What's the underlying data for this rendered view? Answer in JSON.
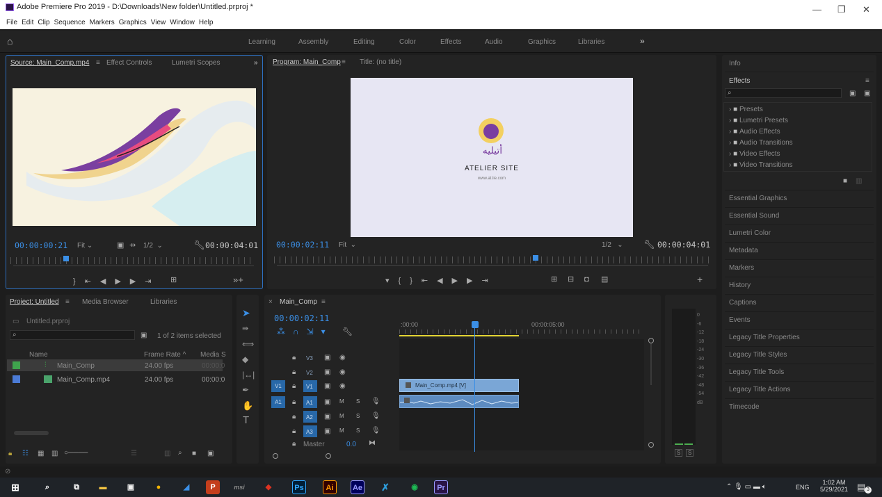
{
  "window": {
    "title": "Adobe Premiere Pro 2019 - D:\\Downloads\\New folder\\Untitled.prproj *",
    "min_icon": "—",
    "restore_icon": "❐",
    "close_icon": "✕"
  },
  "menu": [
    "File",
    "Edit",
    "Clip",
    "Sequence",
    "Markers",
    "Graphics",
    "View",
    "Window",
    "Help"
  ],
  "workspaces": [
    "Learning",
    "Assembly",
    "Editing",
    "Color",
    "Effects",
    "Audio",
    "Graphics",
    "Libraries"
  ],
  "workspace_more": "»",
  "source_panel": {
    "tabs": [
      "Source: Main_Comp.mp4",
      "Effect Controls",
      "Lumetri Scopes"
    ],
    "menu_icon": "≡",
    "more": "»",
    "timecode": "00:00:00:21",
    "fit": "Fit",
    "resolution": "1/2",
    "duration": "00:00:04:01"
  },
  "program_panel": {
    "tabs": [
      "Program: Main_Comp",
      "Title: (no title)"
    ],
    "menu_icon": "≡",
    "timecode": "00:00:02:11",
    "fit": "Fit",
    "resolution": "1/2",
    "duration": "00:00:04:01",
    "logo_arabic": "أتيليه",
    "logo_title": "ATELIER SITE",
    "logo_url": "www.at.lie.com"
  },
  "right_panel": {
    "info": "Info",
    "effects": "Effects",
    "effects_tree": [
      "Presets",
      "Lumetri Presets",
      "Audio Effects",
      "Audio Transitions",
      "Video Effects",
      "Video Transitions"
    ],
    "sections": [
      "Essential Graphics",
      "Essential Sound",
      "Lumetri Color",
      "Metadata",
      "Markers",
      "History",
      "Captions",
      "Events",
      "Legacy Title Properties",
      "Legacy Title Styles",
      "Legacy Title Tools",
      "Legacy Title Actions",
      "Timecode"
    ]
  },
  "project_panel": {
    "tabs": [
      "Project: Untitled",
      "Media Browser",
      "Libraries"
    ],
    "file": "Untitled.prproj",
    "items_selected": "1 of 2 items selected",
    "columns": [
      "Name",
      "Frame Rate",
      "Media S"
    ],
    "sort_icon": "^",
    "rows": [
      {
        "name": "Main_Comp",
        "fps": "24.00 fps",
        "media": "00:00:0",
        "color": "#3fa34d"
      },
      {
        "name": "Main_Comp.mp4",
        "fps": "24.00 fps",
        "media": "00:00:0",
        "color": "#4b7bd6"
      }
    ]
  },
  "timeline": {
    "tab": "Main_Comp",
    "menu_icon": "≡",
    "timecode": "00:00:02:11",
    "ruler_start": ":00:00",
    "ruler_mid": "00:00:05:00",
    "tracks": [
      {
        "src": "",
        "name": "V3"
      },
      {
        "src": "",
        "name": "V2"
      },
      {
        "src": "V1",
        "name": "V1"
      },
      {
        "src": "A1",
        "name": "A1"
      },
      {
        "src": "",
        "name": "A2"
      },
      {
        "src": "",
        "name": "A3"
      }
    ],
    "clip_video": "Main_Comp.mp4 [V]",
    "master": "Master",
    "master_val": "0.0",
    "m": "M",
    "s": "S"
  },
  "meter": {
    "scale": [
      "0",
      "-6",
      "-12",
      "-18",
      "-24",
      "-30",
      "-36",
      "-42",
      "-48",
      "-54",
      "dB"
    ],
    "solo": [
      "S",
      "S"
    ]
  },
  "taskbar": {
    "time": "1:02 AM",
    "date": "5/29/2021",
    "lang": "ENG",
    "apps": [
      {
        "label": "Ps",
        "color": "#31a8ff",
        "bg": "#001e36"
      },
      {
        "label": "Ai",
        "color": "#ff9a00",
        "bg": "#330000"
      },
      {
        "label": "Ae",
        "color": "#9999ff",
        "bg": "#00005b"
      },
      {
        "label": "Pr",
        "color": "#9999ff",
        "bg": "#2a1446"
      }
    ],
    "notifications": "3"
  }
}
